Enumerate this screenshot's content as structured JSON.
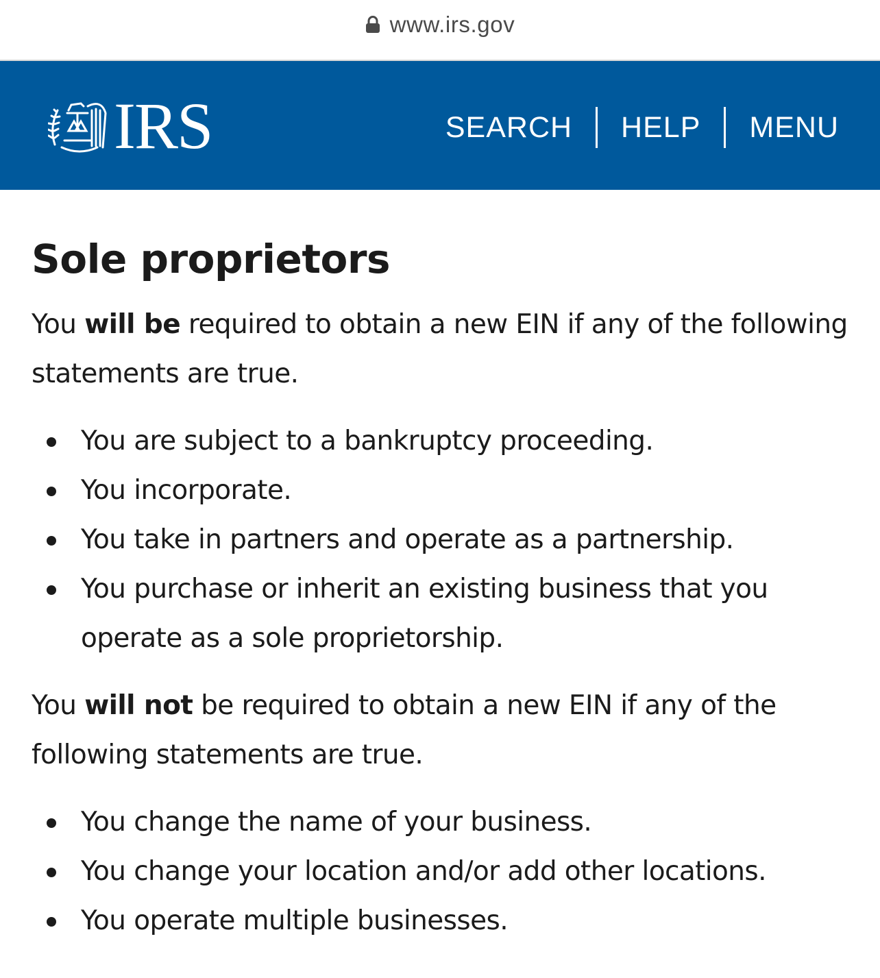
{
  "browser": {
    "url": "www.irs.gov",
    "lock_icon": "lock-icon"
  },
  "header": {
    "logo_text": "IRS",
    "logo_icon": "eagle-seal-icon",
    "background_color": "#00599c",
    "nav": {
      "search": "SEARCH",
      "help": "HELP",
      "menu": "MENU"
    }
  },
  "main": {
    "title": "Sole proprietors",
    "required": {
      "intro_before": "You ",
      "intro_bold": "will be",
      "intro_after": " required to obtain a new EIN if any of the following statements are true.",
      "items": [
        "You are subject to a bankruptcy proceeding.",
        "You incorporate.",
        "You take in partners and operate as a partnership.",
        "You purchase or inherit an existing business that you operate as a sole proprietorship."
      ]
    },
    "not_required": {
      "intro_before": "You ",
      "intro_bold": "will not",
      "intro_after": " be required to obtain a new EIN if any of the following statements are true.",
      "items": [
        "You change the name of your business.",
        "You change your location and/or add other locations.",
        "You operate multiple businesses."
      ]
    }
  }
}
